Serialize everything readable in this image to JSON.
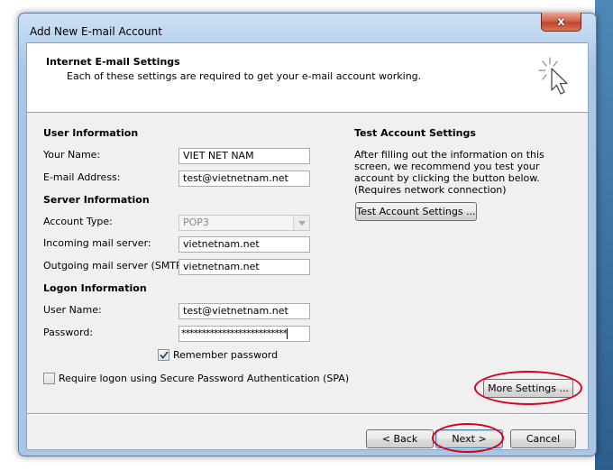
{
  "window": {
    "title": "Add New E-mail Account",
    "close_glyph": "x"
  },
  "header": {
    "title": "Internet E-mail Settings",
    "subtitle": "Each of these settings are required to get your e-mail account working."
  },
  "user_info": {
    "heading": "User Information",
    "name_label": "Your Name:",
    "name_value": "VIET NET NAM",
    "email_label": "E-mail Address:",
    "email_value": "test@vietnetnam.net"
  },
  "server_info": {
    "heading": "Server Information",
    "account_type_label": "Account Type:",
    "account_type_value": "POP3",
    "incoming_label": "Incoming mail server:",
    "incoming_value": "vietnetnam.net",
    "outgoing_label": "Outgoing mail server (SMTP):",
    "outgoing_value": "vietnetnam.net"
  },
  "logon_info": {
    "heading": "Logon Information",
    "username_label": "User Name:",
    "username_value": "test@vietnetnam.net",
    "password_label": "Password:",
    "password_value": "**************************",
    "remember_label": "Remember password",
    "remember_checked": true,
    "spa_label": "Require logon using Secure Password Authentication (SPA)",
    "spa_checked": false
  },
  "test_settings": {
    "heading": "Test Account Settings",
    "description": "After filling out the information on this screen, we recommend you test your account by clicking the button below. (Requires network connection)",
    "button_label": "Test Account Settings ..."
  },
  "buttons": {
    "more_settings": "More Settings ...",
    "back": "< Back",
    "next": "Next >",
    "cancel": "Cancel"
  },
  "colors": {
    "highlight_ellipse": "#d8001c",
    "dialog_background": "#f0f0f0"
  }
}
